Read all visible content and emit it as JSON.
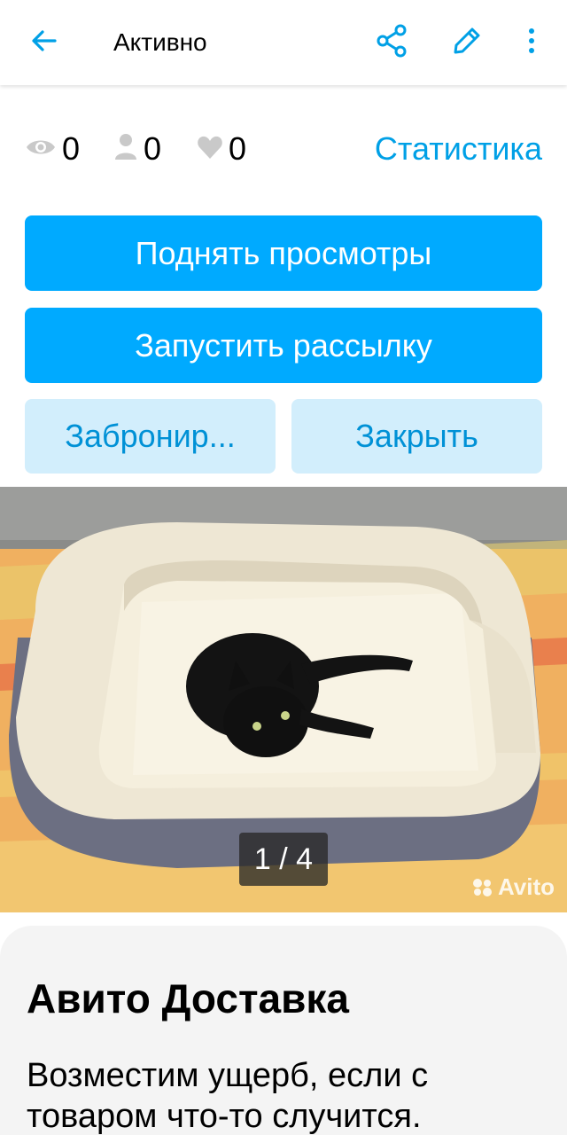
{
  "appbar": {
    "title": "Активно",
    "icons": [
      "arrow-back-icon",
      "share-icon",
      "pencil-icon",
      "more-vertical-icon"
    ],
    "accent_color": "#00a0e6"
  },
  "stats": {
    "views": "0",
    "contacts": "0",
    "favorites": "0",
    "link_label": "Статистика"
  },
  "actions": {
    "raise_views": "Поднять просмотры",
    "start_mailing": "Запустить рассылку",
    "reserve": "Забронир...",
    "close": "Закрыть"
  },
  "gallery": {
    "counter": "1 / 4",
    "watermark": "Avito"
  },
  "delivery": {
    "title": "Авито Доставка",
    "text": "Возместим ущерб, если с товаром что-то случится."
  },
  "colors": {
    "primary_button": "#00aaff",
    "secondary_button": "#d2eefc",
    "secondary_text": "#0091d6"
  }
}
